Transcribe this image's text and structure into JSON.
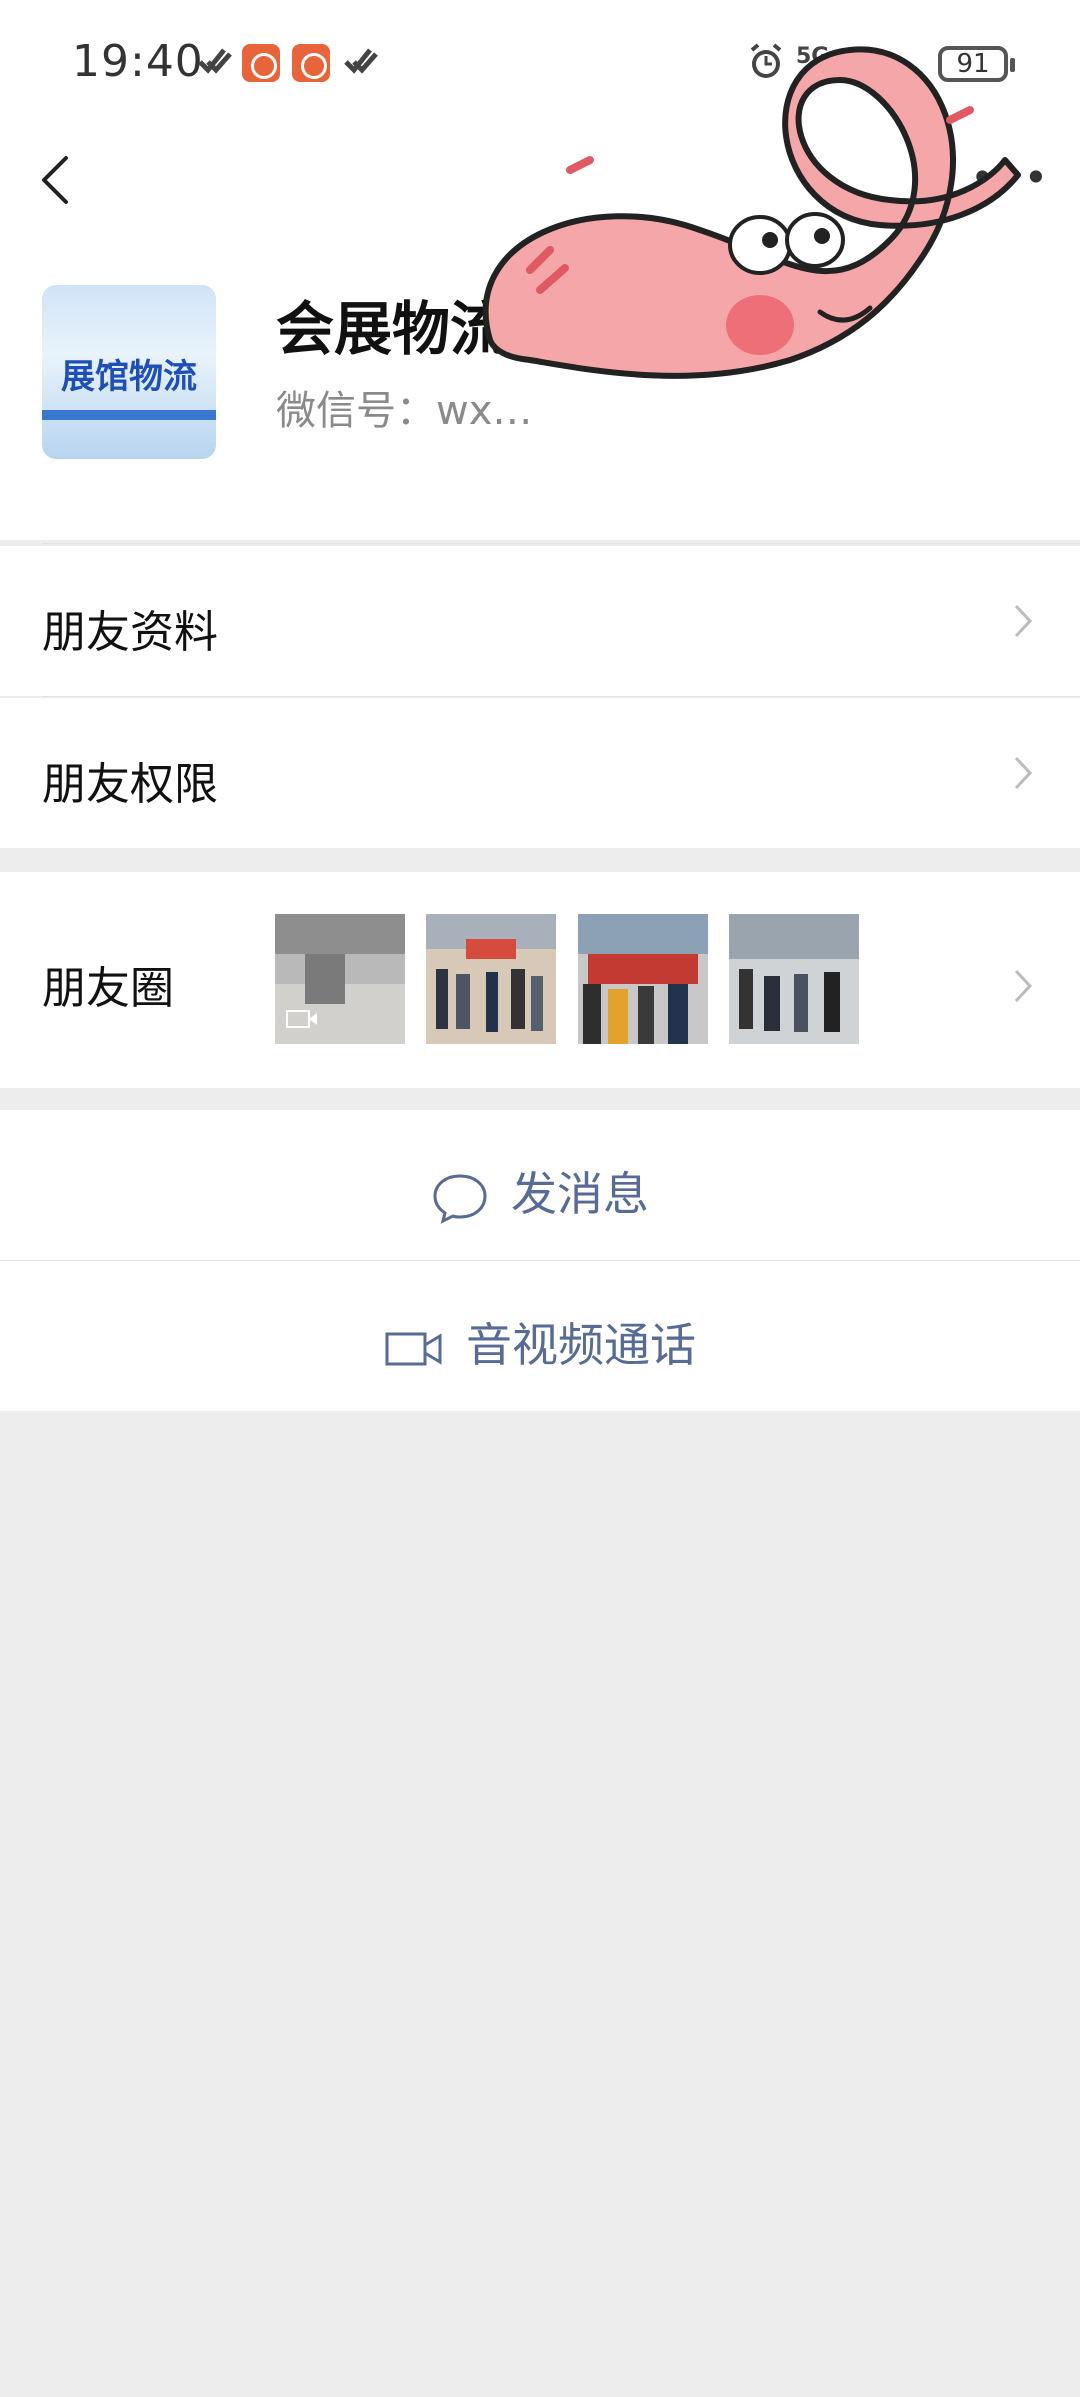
{
  "status_bar": {
    "time": "19:40",
    "battery": "91",
    "network": "5G"
  },
  "profile": {
    "avatar_text": "展馆物流",
    "display_name": "会展物流…张经理",
    "wechat_id": "微信号：wx…"
  },
  "menu": {
    "friend_info": "朋友资料",
    "friend_permissions": "朋友权限",
    "moments": "朋友圈"
  },
  "actions": {
    "send_message": "发消息",
    "av_call": "音视频通话"
  },
  "colors": {
    "link_blue": "#576b95",
    "page_bg": "#ededed",
    "sticker_pink": "#f4a6a8"
  }
}
